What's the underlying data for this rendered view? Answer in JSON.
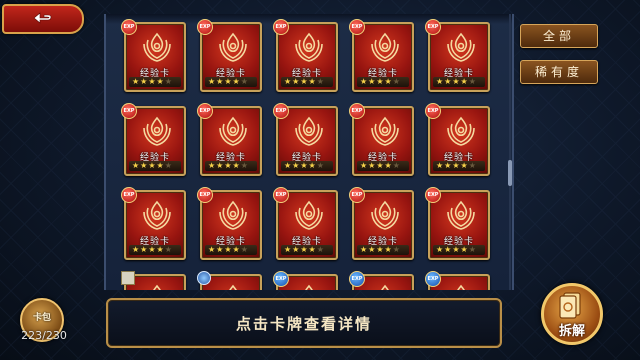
{
  "back_button": {
    "icon": "return-arrow-icon"
  },
  "filters": [
    {
      "label": "全部"
    },
    {
      "label": "稀有度"
    }
  ],
  "cards": [
    {
      "name": "经验卡",
      "badge": "EXP",
      "badge_color": "red",
      "stars": 4
    },
    {
      "name": "经验卡",
      "badge": "EXP",
      "badge_color": "red",
      "stars": 4
    },
    {
      "name": "经验卡",
      "badge": "EXP",
      "badge_color": "red",
      "stars": 4
    },
    {
      "name": "经验卡",
      "badge": "EXP",
      "badge_color": "red",
      "stars": 4
    },
    {
      "name": "经验卡",
      "badge": "EXP",
      "badge_color": "red",
      "stars": 4
    },
    {
      "name": "经验卡",
      "badge": "EXP",
      "badge_color": "red",
      "stars": 4
    },
    {
      "name": "经验卡",
      "badge": "EXP",
      "badge_color": "red",
      "stars": 4
    },
    {
      "name": "经验卡",
      "badge": "EXP",
      "badge_color": "red",
      "stars": 4
    },
    {
      "name": "经验卡",
      "badge": "EXP",
      "badge_color": "red",
      "stars": 4
    },
    {
      "name": "经验卡",
      "badge": "EXP",
      "badge_color": "red",
      "stars": 4
    },
    {
      "name": "经验卡",
      "badge": "EXP",
      "badge_color": "red",
      "stars": 4
    },
    {
      "name": "经验卡",
      "badge": "EXP",
      "badge_color": "red",
      "stars": 4
    },
    {
      "name": "经验卡",
      "badge": "EXP",
      "badge_color": "red",
      "stars": 4
    },
    {
      "name": "经验卡",
      "badge": "EXP",
      "badge_color": "red",
      "stars": 4
    },
    {
      "name": "经验卡",
      "badge": "EXP",
      "badge_color": "red",
      "stars": 4
    },
    {
      "name": "",
      "badge": "",
      "badge_color": "square",
      "stars": 0
    },
    {
      "name": "",
      "badge": "",
      "badge_color": "round-blue",
      "stars": 0
    },
    {
      "name": "",
      "badge": "EXP",
      "badge_color": "blue",
      "stars": 0
    },
    {
      "name": "",
      "badge": "EXP",
      "badge_color": "blue",
      "stars": 0
    },
    {
      "name": "",
      "badge": "EXP",
      "badge_color": "blue",
      "stars": 0
    }
  ],
  "hint_bar": {
    "text": "点击卡牌查看详情"
  },
  "card_bag": {
    "label": "卡包",
    "count": "223/230"
  },
  "dismantle_button": {
    "label": "拆解"
  },
  "colors": {
    "card_red": "#981510",
    "card_border": "#c7a15a",
    "star": "#f7d24a",
    "accent_gold": "#d6a55a"
  }
}
